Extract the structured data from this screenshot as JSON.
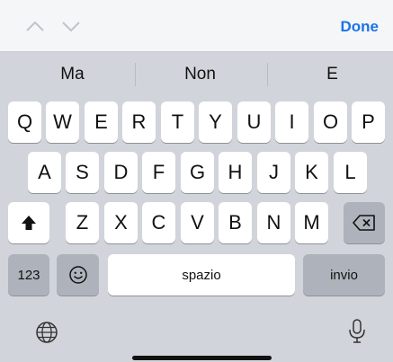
{
  "toolbar": {
    "prev_icon": "chevron-up-icon",
    "next_icon": "chevron-down-icon",
    "done_label": "Done",
    "accent": "#1a73e8"
  },
  "suggestions": [
    "Ma",
    "Non",
    "E"
  ],
  "keyboard": {
    "row1": [
      "Q",
      "W",
      "E",
      "R",
      "T",
      "Y",
      "U",
      "I",
      "O",
      "P"
    ],
    "row2": [
      "A",
      "S",
      "D",
      "F",
      "G",
      "H",
      "J",
      "K",
      "L"
    ],
    "row3": [
      "Z",
      "X",
      "C",
      "V",
      "B",
      "N",
      "M"
    ],
    "shift_icon": "shift-arrow-icon",
    "backspace_icon": "backspace-icon",
    "numbers_label": "123",
    "emoji_icon": "emoji-icon",
    "space_label": "spazio",
    "return_label": "invio",
    "globe_icon": "globe-icon",
    "mic_icon": "microphone-icon"
  }
}
